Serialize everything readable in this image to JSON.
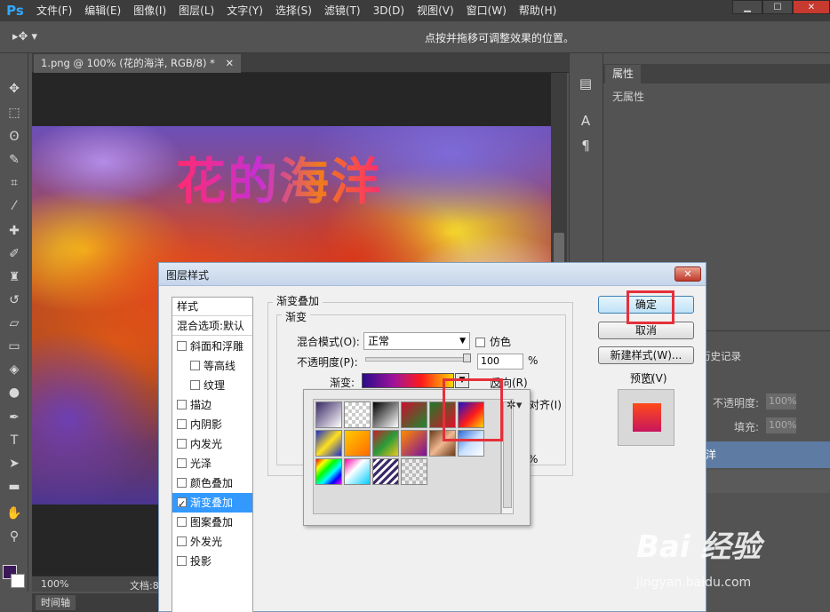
{
  "app": {
    "logo": "Ps",
    "menus": [
      "文件(F)",
      "编辑(E)",
      "图像(I)",
      "图层(L)",
      "文字(Y)",
      "选择(S)",
      "滤镜(T)",
      "3D(D)",
      "视图(V)",
      "窗口(W)",
      "帮助(H)"
    ],
    "window_controls": {
      "minimize": "▁",
      "maximize": "☐",
      "close": "✕"
    }
  },
  "options_bar": {
    "tool_glyph": "▸✥ ▾",
    "hint": "点按并拖移可调整效果的位置。"
  },
  "document": {
    "tab_title": "1.png @ 100% (花的海洋, RGB/8) *",
    "tab_close": "✕",
    "artwork_text": "花的海洋",
    "zoom": "100%",
    "doc_info": "文档:8",
    "timeline_tab": "时间轴"
  },
  "properties_panel": {
    "tab": "属性",
    "empty_text": "无属性"
  },
  "layers_panel": {
    "tab": "历史记录",
    "opacity_label": "不透明度:",
    "opacity_value": "100%",
    "fill_label": "填充:",
    "fill_value": "100%",
    "layer_name": "洋"
  },
  "dialog": {
    "title": "图层样式",
    "close": "✕",
    "style_list_header": "样式",
    "blend_options": "混合选项:默认",
    "styles": [
      {
        "label": "斜面和浮雕",
        "checked": false,
        "indent": false,
        "selected": false
      },
      {
        "label": "等高线",
        "checked": false,
        "indent": true,
        "selected": false
      },
      {
        "label": "纹理",
        "checked": false,
        "indent": true,
        "selected": false
      },
      {
        "label": "描边",
        "checked": false,
        "indent": false,
        "selected": false
      },
      {
        "label": "内阴影",
        "checked": false,
        "indent": false,
        "selected": false
      },
      {
        "label": "内发光",
        "checked": false,
        "indent": false,
        "selected": false
      },
      {
        "label": "光泽",
        "checked": false,
        "indent": false,
        "selected": false
      },
      {
        "label": "颜色叠加",
        "checked": false,
        "indent": false,
        "selected": false
      },
      {
        "label": "渐变叠加",
        "checked": true,
        "indent": false,
        "selected": true
      },
      {
        "label": "图案叠加",
        "checked": false,
        "indent": false,
        "selected": false
      },
      {
        "label": "外发光",
        "checked": false,
        "indent": false,
        "selected": false
      },
      {
        "label": "投影",
        "checked": false,
        "indent": false,
        "selected": false
      }
    ],
    "group_title": "渐变叠加",
    "sub_title": "渐变",
    "blend_mode_label": "混合模式(O):",
    "blend_mode_value": "正常",
    "dither_label": "仿色",
    "opacity_label": "不透明度(P):",
    "opacity_value": "100",
    "percent": "%",
    "gradient_label": "渐变:",
    "reverse_label": "反向(R)",
    "align_label": "对齐(I)",
    "ok": "确定",
    "cancel": "取消",
    "new_style": "新建样式(W)...",
    "preview": "预览(V)"
  },
  "watermark": {
    "brand": "Bai 经验",
    "url": "jingyan.baidu.com"
  }
}
